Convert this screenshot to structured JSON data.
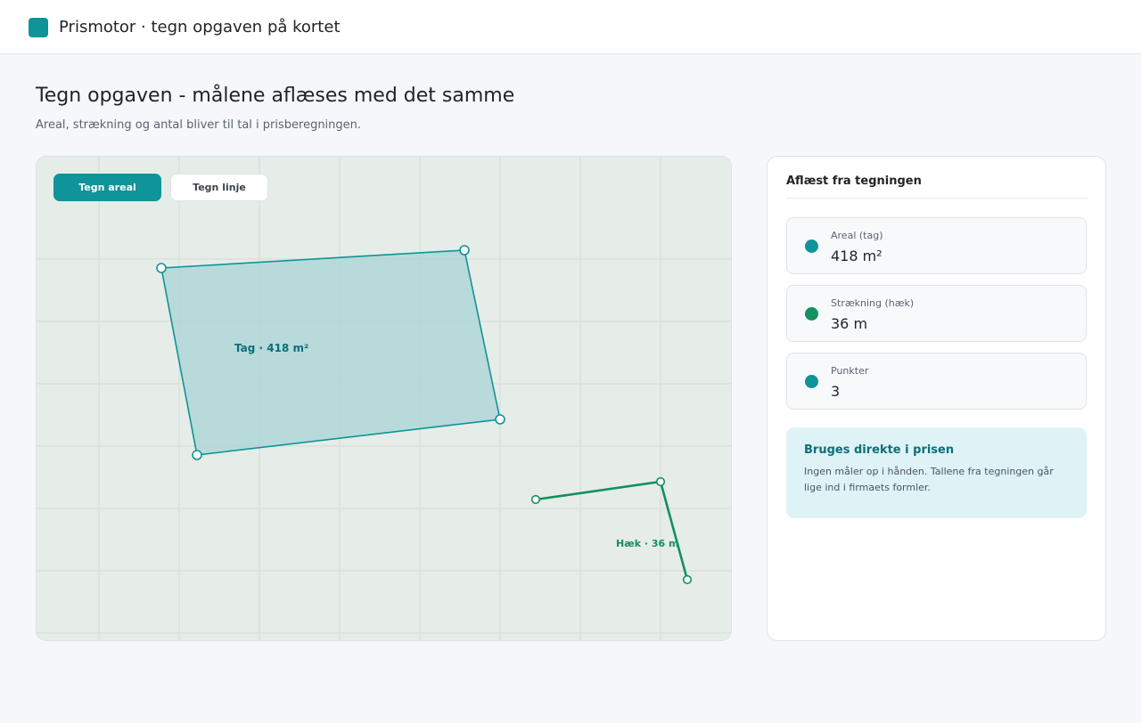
{
  "app": {
    "title": "Prismotor · tegn opgaven på kortet",
    "accent_color": "#0e9499",
    "hedge_color": "#13905f"
  },
  "page": {
    "title": "Tegn opgaven - målene aflæses med det samme",
    "subtitle": "Areal, strækning og antal bliver til tal i prisberegningen."
  },
  "toolbar": {
    "draw_area_label": "Tegn areal",
    "draw_line_label": "Tegn linje",
    "active_tool": "Tegn areal"
  },
  "canvas": {
    "area_label": "Tag · 418 m²",
    "line_label": "Hæk · 36 m"
  },
  "panel": {
    "title": "Aflæst fra tegningen",
    "metrics": [
      {
        "label": "Areal (tag)",
        "value": "418 m²",
        "color": "#0e9499"
      },
      {
        "label": "Strækning (hæk)",
        "value": "36 m",
        "color": "#13905f"
      },
      {
        "label": "Punkter",
        "value": "3",
        "color": "#0e9499"
      }
    ],
    "info": {
      "title": "Bruges direkte i prisen",
      "text": "Ingen måler op i hånden. Tallene fra tegningen går lige ind i firmaets formler."
    }
  }
}
